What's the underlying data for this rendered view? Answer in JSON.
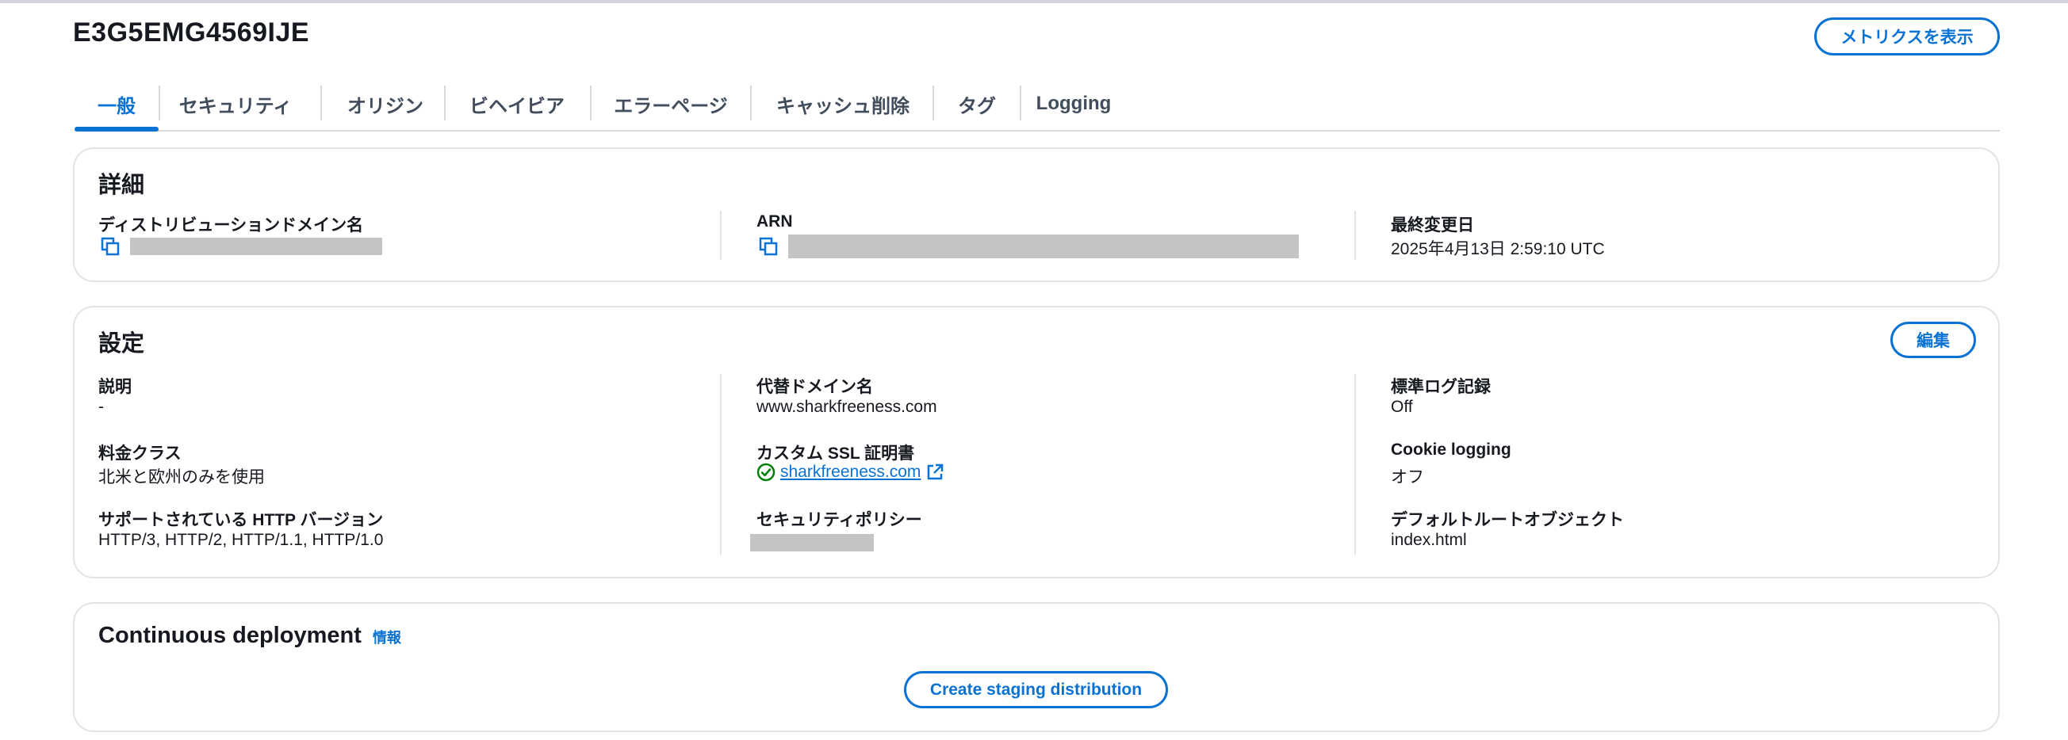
{
  "header": {
    "title": "E3G5EMG4569IJE",
    "metrics_button": "メトリクスを表示"
  },
  "tabs": [
    {
      "label": "一般",
      "active": true
    },
    {
      "label": "セキュリティ"
    },
    {
      "label": "オリジン"
    },
    {
      "label": "ビヘイビア"
    },
    {
      "label": "エラーページ"
    },
    {
      "label": "キャッシュ削除"
    },
    {
      "label": "タグ"
    },
    {
      "label": "Logging"
    }
  ],
  "details": {
    "title": "詳細",
    "domain_label": "ディストリビューションドメイン名",
    "arn_label": "ARN",
    "modified_label": "最終変更日",
    "modified_value": "2025年4月13日 2:59:10 UTC"
  },
  "settings": {
    "title": "設定",
    "edit_button": "編集",
    "description_label": "説明",
    "description_value": "-",
    "price_class_label": "料金クラス",
    "price_class_value": "北米と欧州のみを使用",
    "http_label": "サポートされている HTTP バージョン",
    "http_value": "HTTP/3, HTTP/2, HTTP/1.1, HTTP/1.0",
    "alt_domain_label": "代替ドメイン名",
    "alt_domain_value": "www.sharkfreeness.com",
    "ssl_label": "カスタム SSL 証明書",
    "ssl_value": "sharkfreeness.com",
    "security_policy_label": "セキュリティポリシー",
    "std_log_label": "標準ログ記録",
    "std_log_value": "Off",
    "cookie_label": "Cookie logging",
    "cookie_value": "オフ",
    "default_root_label": "デフォルトルートオブジェクト",
    "default_root_value": "index.html"
  },
  "continuous": {
    "title": "Continuous deployment",
    "info": "情報",
    "staging_button": "Create staging distribution"
  },
  "colors": {
    "accent": "#0972d3",
    "success": "#037f0c",
    "border": "#e0e4e8",
    "redaction": "#c4c4c4"
  },
  "icons": [
    "copy-icon",
    "check-circle-icon",
    "external-link-icon"
  ]
}
